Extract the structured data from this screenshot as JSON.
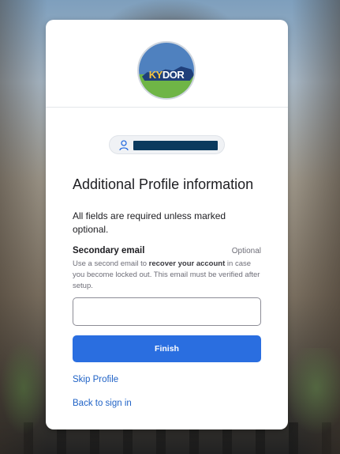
{
  "logo": {
    "ky": "KY",
    "dor": "DOR"
  },
  "user": {
    "icon": "user-icon",
    "identifier_redacted": true
  },
  "form": {
    "title": "Additional Profile information",
    "subtitle": "All fields are required unless marked optional.",
    "secondary_email": {
      "label": "Secondary email",
      "optional_label": "Optional",
      "help_before": "Use a second email to ",
      "help_bold": "recover your account",
      "help_after": " in case you become locked out. This email must be verified after setup.",
      "value": "",
      "placeholder": ""
    },
    "finish_label": "Finish"
  },
  "links": {
    "skip_profile": "Skip Profile",
    "back_to_sign_in": "Back to sign in"
  },
  "colors": {
    "primary_button": "#2a6ee0",
    "link": "#1f62c6",
    "redaction": "#0b3a5e"
  }
}
